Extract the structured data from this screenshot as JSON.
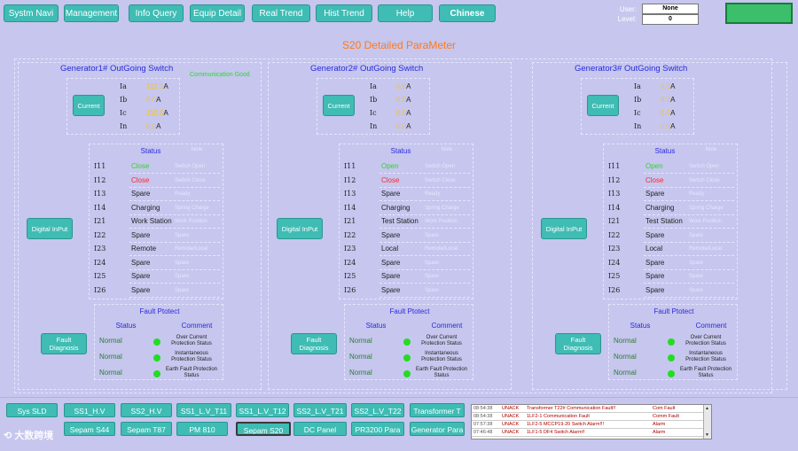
{
  "nav": {
    "buttons": [
      "Systm Navi",
      "Management",
      "Info Query",
      "Equip Detail",
      "Real Trend",
      "Hist Trend",
      "Help",
      "Chinese"
    ],
    "active_index": 7
  },
  "user": {
    "user_label": "User:",
    "user_value": "None",
    "level_label": "Level:",
    "level_value": "0"
  },
  "alarm_indicator": {
    "color": "#3bbf6a"
  },
  "page_title": "S20 Detailed ParaMeter",
  "comm_status": "Communication Good",
  "generators": [
    {
      "title": "Generator1# OutGoing Switch",
      "current_button": "Current",
      "currents": [
        {
          "label": "Ia",
          "value": "112.1",
          "unit": "A"
        },
        {
          "label": "Ib",
          "value": "0.0",
          "unit": "A"
        },
        {
          "label": "Ic",
          "value": "110.2",
          "unit": "A"
        },
        {
          "label": "In",
          "value": "0.0",
          "unit": "A"
        }
      ],
      "input_button": "Digital InPut",
      "status_header": "Status",
      "note_header": "Note",
      "inputs": [
        {
          "id": "I11",
          "status": "Close",
          "color": "#2bd82b",
          "note": "Switch Open"
        },
        {
          "id": "I12",
          "status": "Close",
          "color": "#ff2a2a",
          "note": "Switch Close"
        },
        {
          "id": "I13",
          "status": "Spare",
          "color": "#222",
          "note": "Ready"
        },
        {
          "id": "I14",
          "status": "Charging",
          "color": "#222",
          "note": "Spring Charge"
        },
        {
          "id": "I21",
          "status": "Work Station",
          "color": "#222",
          "note": "Work Position"
        },
        {
          "id": "I22",
          "status": "Spare",
          "color": "#222",
          "note": "Spare"
        },
        {
          "id": "I23",
          "status": "Remote",
          "color": "#222",
          "note": "Remote/Local"
        },
        {
          "id": "I24",
          "status": "Spare",
          "color": "#222",
          "note": "Spare"
        },
        {
          "id": "I25",
          "status": "Spare",
          "color": "#222",
          "note": "Spare"
        },
        {
          "id": "I26",
          "status": "Spare",
          "color": "#222",
          "note": "Spare"
        }
      ],
      "fault_title": "Fault Ptotect",
      "fault_button": "Fault Diagnosis",
      "fault_status_header": "Status",
      "fault_comment_header": "Comment",
      "faults": [
        {
          "status": "Normal",
          "comment": "Over Current Protection Status"
        },
        {
          "status": "Normal",
          "comment": "Instantaneous Protection Status"
        },
        {
          "status": "Normal",
          "comment": "Earth Fault Protection Status"
        }
      ]
    },
    {
      "title": "Generator2# OutGoing Switch",
      "current_button": "Current",
      "currents": [
        {
          "label": "Ia",
          "value": "0.0",
          "unit": "A"
        },
        {
          "label": "Ib",
          "value": "0.0",
          "unit": "A"
        },
        {
          "label": "Ic",
          "value": "0.0",
          "unit": "A"
        },
        {
          "label": "In",
          "value": "0.0",
          "unit": "A"
        }
      ],
      "input_button": "Digital InPut",
      "status_header": "Status",
      "note_header": "Note",
      "inputs": [
        {
          "id": "I11",
          "status": "Open",
          "color": "#2bd82b",
          "note": "Switch Open"
        },
        {
          "id": "I12",
          "status": "Close",
          "color": "#ff2a2a",
          "note": "Switch Close"
        },
        {
          "id": "I13",
          "status": "Spare",
          "color": "#222",
          "note": "Ready"
        },
        {
          "id": "I14",
          "status": "Charging",
          "color": "#222",
          "note": "Spring Charge"
        },
        {
          "id": "I21",
          "status": "Test Station",
          "color": "#222",
          "note": "Work Position"
        },
        {
          "id": "I22",
          "status": "Spare",
          "color": "#222",
          "note": "Spare"
        },
        {
          "id": "I23",
          "status": "Local",
          "color": "#222",
          "note": "Remote/Local"
        },
        {
          "id": "I24",
          "status": "Spare",
          "color": "#222",
          "note": "Spare"
        },
        {
          "id": "I25",
          "status": "Spare",
          "color": "#222",
          "note": "Spare"
        },
        {
          "id": "I26",
          "status": "Spare",
          "color": "#222",
          "note": "Spare"
        }
      ],
      "fault_title": "Fault Ptotect",
      "fault_button": "Fault Diagnosis",
      "fault_status_header": "Status",
      "fault_comment_header": "Comment",
      "faults": [
        {
          "status": "Normal",
          "comment": "Over Current Protection Status"
        },
        {
          "status": "Normal",
          "comment": "Instantaneous Protection Status"
        },
        {
          "status": "Normal",
          "comment": "Earth Fault Protection Status"
        }
      ]
    },
    {
      "title": "Generator3# OutGoing Switch",
      "current_button": "Current",
      "currents": [
        {
          "label": "Ia",
          "value": "0.0",
          "unit": "A"
        },
        {
          "label": "Ib",
          "value": "0.0",
          "unit": "A"
        },
        {
          "label": "Ic",
          "value": "0.0",
          "unit": "A"
        },
        {
          "label": "In",
          "value": "0.0",
          "unit": "A"
        }
      ],
      "input_button": "Digital InPut",
      "status_header": "Status",
      "note_header": "Note",
      "inputs": [
        {
          "id": "I11",
          "status": "Open",
          "color": "#2bd82b",
          "note": "Switch Open"
        },
        {
          "id": "I12",
          "status": "Close",
          "color": "#ff2a2a",
          "note": "Switch Close"
        },
        {
          "id": "I13",
          "status": "Spare",
          "color": "#222",
          "note": "Ready"
        },
        {
          "id": "I14",
          "status": "Charging",
          "color": "#222",
          "note": "Spring Charge"
        },
        {
          "id": "I21",
          "status": "Test Station",
          "color": "#222",
          "note": "Work Position"
        },
        {
          "id": "I22",
          "status": "Spare",
          "color": "#222",
          "note": "Spare"
        },
        {
          "id": "I23",
          "status": "Local",
          "color": "#222",
          "note": "Remote/Local"
        },
        {
          "id": "I24",
          "status": "Spare",
          "color": "#222",
          "note": "Spare"
        },
        {
          "id": "I25",
          "status": "Spare",
          "color": "#222",
          "note": "Spare"
        },
        {
          "id": "I26",
          "status": "Spare",
          "color": "#222",
          "note": "Spare"
        }
      ],
      "fault_title": "Fault Ptotect",
      "fault_button": "Fault Diagnosis",
      "fault_status_header": "Status",
      "fault_comment_header": "Comment",
      "faults": [
        {
          "status": "Normal",
          "comment": "Over Current Protection Status"
        },
        {
          "status": "Normal",
          "comment": "Instantaneous Protection Status"
        },
        {
          "status": "Normal",
          "comment": "Earth Fault Protection Status"
        }
      ]
    }
  ],
  "bottom_nav": {
    "row1": [
      "Sys SLD",
      "SS1_H.V",
      "SS2_H.V",
      "SS1_L.V_T11",
      "SS1_L.V_T12",
      "SS2_L.V_T21",
      "SS2_L.V_T22",
      "Transformer T"
    ],
    "row2": [
      "Sepam S44",
      "Sepam T87",
      "PM 810",
      "Sepam S20",
      "DC Panel",
      "PR3200 Para",
      "Generator Para"
    ],
    "selected": "Sepam S20"
  },
  "alarms": [
    {
      "time": "08:54:38",
      "ack": "UNACK",
      "desc": "Transformer T22# Communication Fault!!",
      "type": "Com Fault"
    },
    {
      "time": "08:54:38",
      "ack": "UNACK",
      "desc": "1LF2-1 Communication Fault",
      "type": "Comm Fault"
    },
    {
      "time": "07:57:38",
      "ack": "UNACK",
      "desc": "1LF2-5 MCCP19-20 Switch Alarm!!!",
      "type": "Alarm"
    },
    {
      "time": "07:46:48",
      "ack": "UNACK",
      "desc": "1LF1-5 DF4 Switch Alarm!!",
      "type": "Alarm"
    }
  ],
  "logo_text": "大数跨境"
}
